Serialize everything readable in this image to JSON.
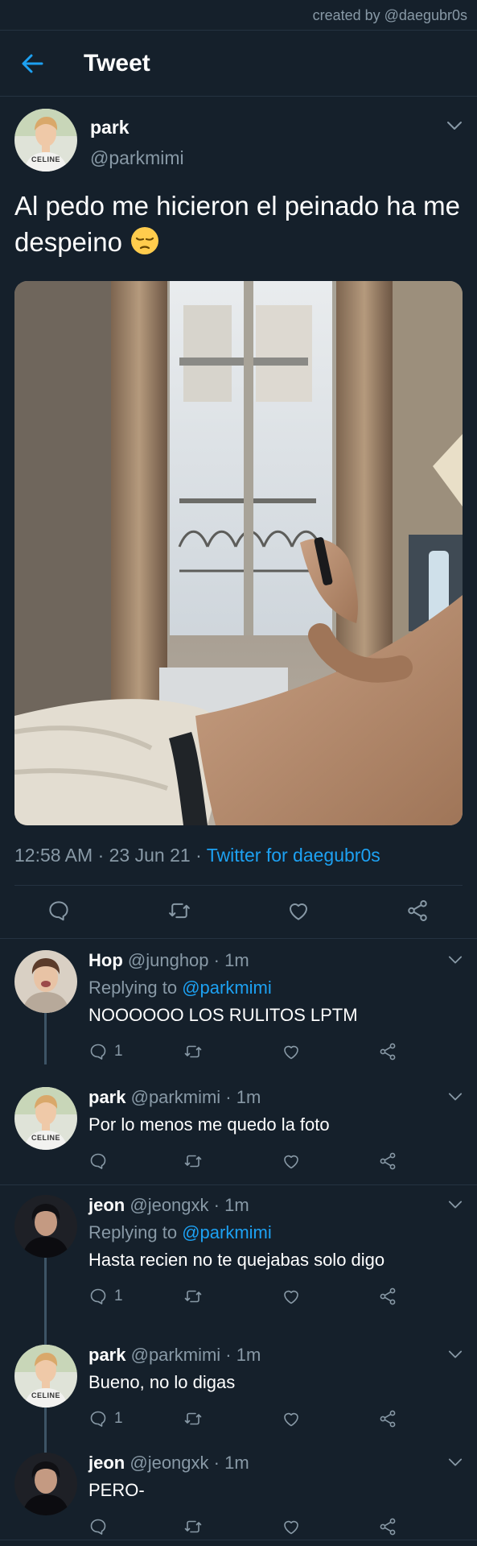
{
  "watermark": "created by @daegubr0s",
  "header": {
    "title": "Tweet"
  },
  "main_tweet": {
    "name": "park",
    "handle": "@parkmimi",
    "text": "Al pedo me hicieron el peinado ha me despeino",
    "time": "12:58 AM",
    "date": "23 Jun 21",
    "source": "Twitter for daegubr0s",
    "avatar_shirt_text": "CELINE"
  },
  "replies": [
    {
      "name": "Hop",
      "handle": "@junghop",
      "time": "1m",
      "replying_prefix": "Replying to",
      "replying_to": "@parkmimi",
      "text": "NOOOOOO LOS RULITOS LPTM",
      "reply_count": "1"
    },
    {
      "name": "park",
      "handle": "@parkmimi",
      "time": "1m",
      "text": "Por lo menos me quedo la foto",
      "avatar_shirt_text": "CELINE"
    },
    {
      "name": "jeon",
      "handle": "@jeongxk",
      "time": "1m",
      "replying_prefix": "Replying to",
      "replying_to": "@parkmimi",
      "text": "Hasta recien no te quejabas solo digo",
      "reply_count": "1"
    },
    {
      "name": "park",
      "handle": "@parkmimi",
      "time": "1m",
      "text": "Bueno, no lo digas",
      "reply_count": "1",
      "avatar_shirt_text": "CELINE"
    },
    {
      "name": "jeon",
      "handle": "@jeongxk",
      "time": "1m",
      "text": "PERO-"
    }
  ],
  "colors": {
    "background": "#15202b",
    "accent": "#1da1f2",
    "secondary_text": "#8899a6",
    "divider": "#253341"
  },
  "icons": [
    "back-arrow-icon",
    "chevron-down-icon",
    "reply-icon",
    "retweet-icon",
    "like-icon",
    "share-icon",
    "pensive-face-emoji"
  ]
}
